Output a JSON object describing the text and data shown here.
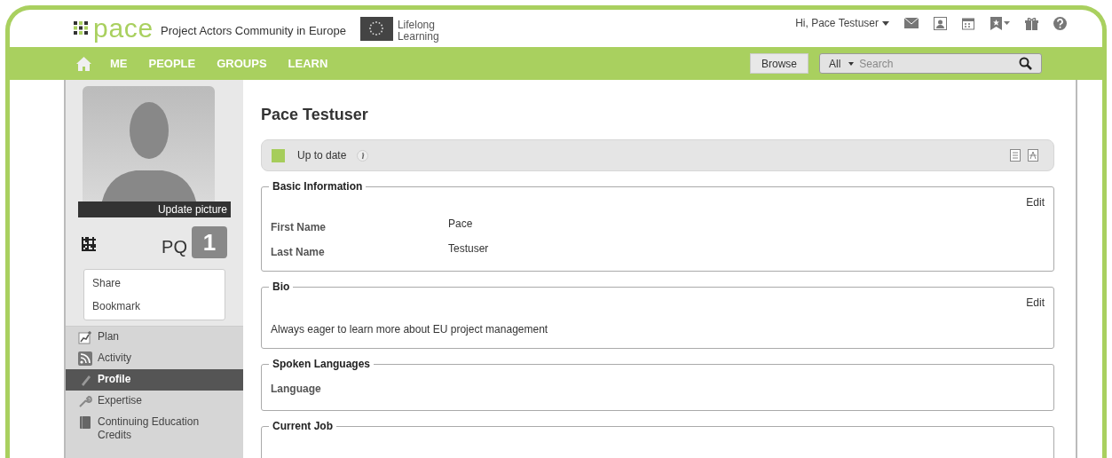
{
  "header": {
    "logo": "pace",
    "tagline": "Project Actors Community in Europe",
    "partner": "Lifelong\nLearning",
    "greeting": "Hi, Pace Testuser"
  },
  "nav": {
    "items": [
      {
        "label": "ME",
        "selected": false
      },
      {
        "label": "PEOPLE",
        "selected": false
      },
      {
        "label": "GROUPS",
        "selected": false
      },
      {
        "label": "LEARN",
        "selected": false
      }
    ],
    "browse": "Browse",
    "scope": "All",
    "search": {
      "placeholder": "Search"
    }
  },
  "profile": {
    "update_picture": "Update picture",
    "initials": "PQ",
    "badge": "1",
    "actions": [
      "Share",
      "Bookmark"
    ]
  },
  "sidebar": {
    "items": [
      {
        "kind": "plan",
        "label": "Plan",
        "selected": false
      },
      {
        "kind": "activity",
        "label": "Activity",
        "selected": false
      },
      {
        "kind": "profile",
        "label": "Profile",
        "selected": true
      },
      {
        "kind": "expertise",
        "label": "Expertise",
        "selected": false
      },
      {
        "kind": "credits",
        "label": "Continuing Education Credits",
        "selected": false
      }
    ]
  },
  "main": {
    "name": "Pace Testuser",
    "status": {
      "label": "Up to date",
      "color": "#a6cd5b"
    },
    "sections": [
      {
        "title": "Basic Information",
        "edit": "Edit",
        "fields": [
          {
            "label": "First Name",
            "value": "Pace"
          },
          {
            "label": "Last Name",
            "value": "Testuser"
          }
        ]
      },
      {
        "title": "Bio",
        "edit": "Edit",
        "text": "Always eager to learn more about EU project management"
      },
      {
        "title": "Spoken Languages",
        "fields": [
          {
            "label": "Language"
          }
        ]
      },
      {
        "title": "Current Job"
      }
    ]
  }
}
